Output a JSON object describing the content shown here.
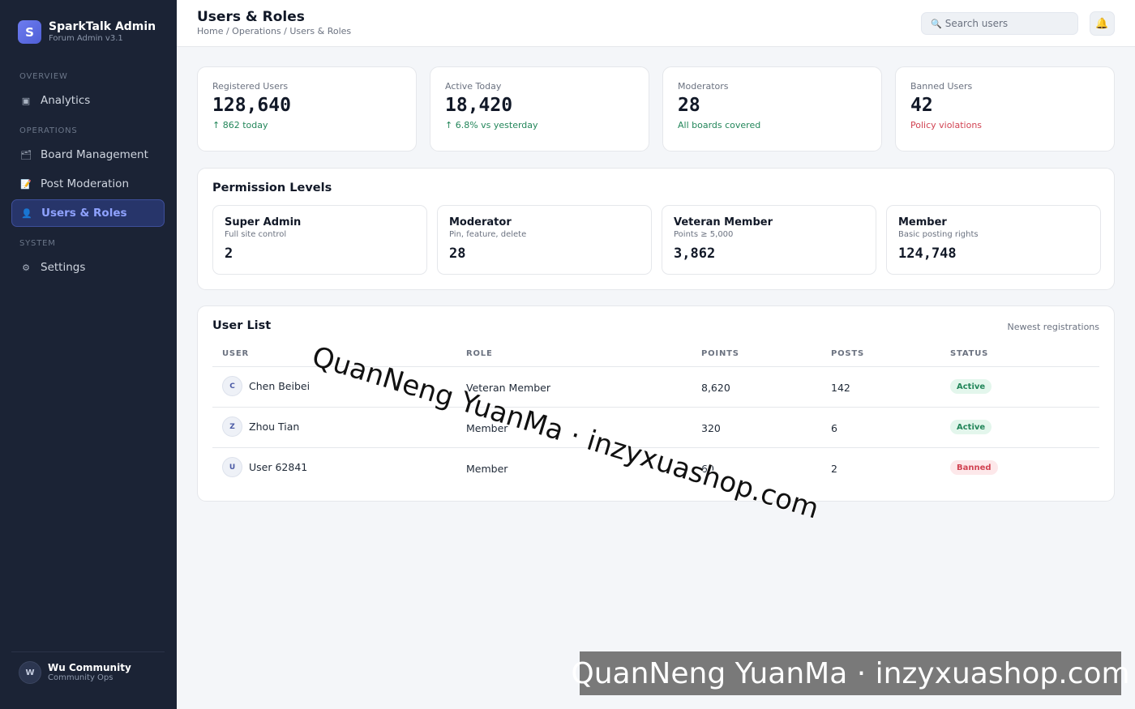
{
  "brand": {
    "logo_letter": "S",
    "name": "SparkTalk Admin",
    "version": "Forum Admin v3.1"
  },
  "sidebar": {
    "sections": [
      {
        "label": "OVERVIEW"
      },
      {
        "label": "OPERATIONS"
      },
      {
        "label": "SYSTEM"
      }
    ],
    "items": [
      {
        "label": "Analytics",
        "icon": "▣"
      },
      {
        "label": "Board Management",
        "icon": "🗂"
      },
      {
        "label": "Post Moderation",
        "icon": "📝"
      },
      {
        "label": "Users & Roles",
        "icon": "👤"
      },
      {
        "label": "Settings",
        "icon": "⚙"
      }
    ],
    "profile": {
      "initial": "W",
      "name": "Wu Community",
      "role": "Community Ops"
    }
  },
  "header": {
    "title": "Users & Roles",
    "breadcrumb": "Home / Operations / Users & Roles",
    "search_placeholder": "Search users",
    "search_icon": "🔍",
    "bell_icon": "🔔"
  },
  "stats": [
    {
      "label": "Registered Users",
      "value": "128,640",
      "note": "↑ 862 today",
      "note_color": "#23865a"
    },
    {
      "label": "Active Today",
      "value": "18,420",
      "note": "↑ 6.8% vs yesterday",
      "note_color": "#23865a"
    },
    {
      "label": "Moderators",
      "value": "28",
      "note": "All boards covered",
      "note_color": "#23865a"
    },
    {
      "label": "Banned Users",
      "value": "42",
      "note": "Policy violations",
      "note_color": "#d14352"
    }
  ],
  "permissions": {
    "title": "Permission Levels",
    "levels": [
      {
        "name": "Super Admin",
        "desc": "Full site control",
        "count": "2"
      },
      {
        "name": "Moderator",
        "desc": "Pin, feature, delete",
        "count": "28"
      },
      {
        "name": "Veteran Member",
        "desc": "Points ≥ 5,000",
        "count": "3,862"
      },
      {
        "name": "Member",
        "desc": "Basic posting rights",
        "count": "124,748"
      }
    ]
  },
  "user_list": {
    "title": "User List",
    "subtitle": "Newest registrations",
    "columns": [
      "USER",
      "ROLE",
      "POINTS",
      "POSTS",
      "STATUS"
    ],
    "rows": [
      {
        "initial": "C",
        "name": "Chen Beibei",
        "role": "Veteran Member",
        "points": "8,620",
        "posts": "142",
        "status": "Active"
      },
      {
        "initial": "Z",
        "name": "Zhou Tian",
        "role": "Member",
        "points": "320",
        "posts": "6",
        "status": "Active"
      },
      {
        "initial": "U",
        "name": "User 62841",
        "role": "Member",
        "points": "60",
        "posts": "2",
        "status": "Banned"
      }
    ]
  },
  "watermark": {
    "text": "QuanNeng YuanMa · inzyxuashop.com"
  }
}
